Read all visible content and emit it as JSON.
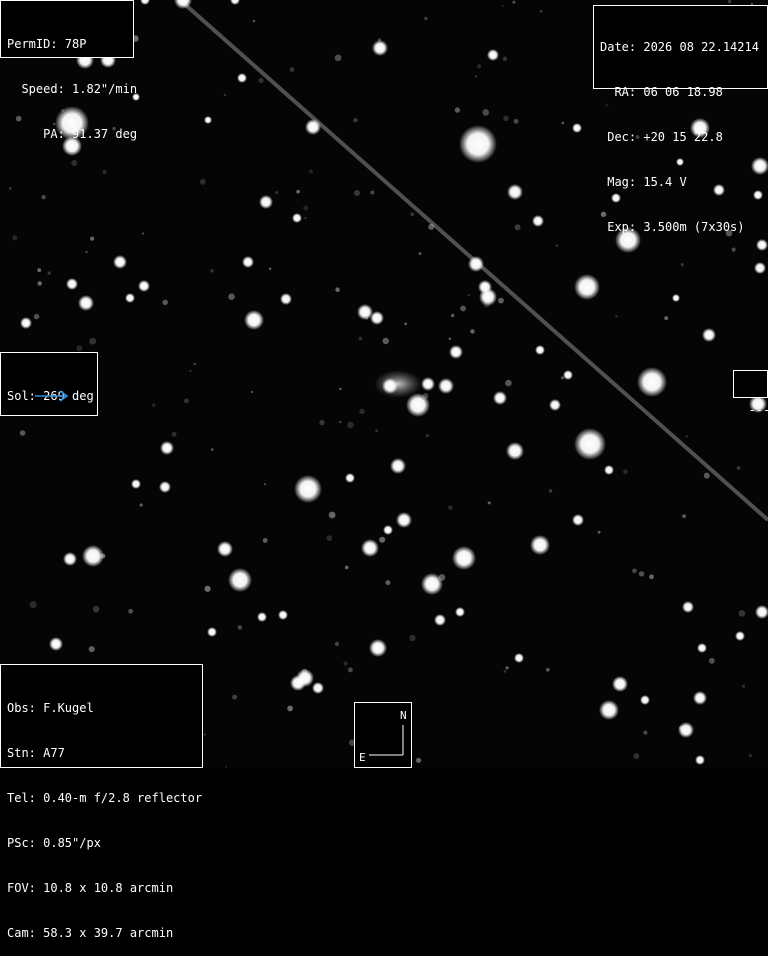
{
  "info_left": {
    "permid": "PermID: 78P",
    "speed": "  Speed: 1.82\"/min",
    "pa": "     PA: 91.37 deg"
  },
  "info_right": {
    "date": "Date: 2026 08 22.14214",
    "ra": "  RA: 06 06 18.98",
    "dec": " Dec: +20 15 22.8",
    "mag": " Mag: 15.4 V",
    "exp": " Exp: 3.500m (7x30s)"
  },
  "sol": {
    "label": "Sol: 269 deg",
    "arrow_color": "#2e8fd8"
  },
  "marker": {
    "label": "---"
  },
  "observer": {
    "obs": "Obs: F.Kugel",
    "stn": "Stn: A77",
    "tel": "Tel: 0.40-m f/2.8 reflector",
    "psc": "PSc: 0.85\"/px",
    "fov": "FOV: 10.8 x 10.8 arcmin",
    "cam": "Cam: 58.3 x 39.7 arcmin"
  },
  "compass": {
    "north": "N",
    "east": "E"
  }
}
